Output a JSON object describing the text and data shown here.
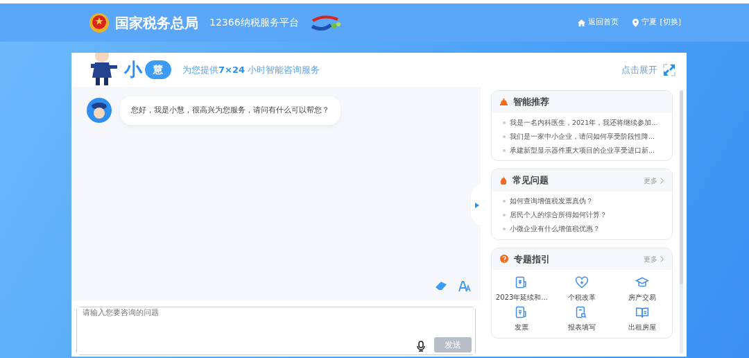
{
  "header": {
    "brand": "国家税务总局",
    "platform": "12366纳税服务平台",
    "nav": [
      {
        "kind": "home",
        "label": "返回首页"
      },
      {
        "kind": "location",
        "label": "宁夏"
      },
      {
        "kind": "switch",
        "label": "[切换]"
      }
    ]
  },
  "assistant": {
    "logo_a": "小",
    "logo_b": "慧",
    "tagline": "为您提供**7×24** 小时智能咨询服务",
    "expand": "点击展开"
  },
  "messages": [
    {
      "text": "您好，我是小慧，很高兴为您服务，请问有什么可以帮您？"
    }
  ],
  "input": {
    "placeholder": "请输入您要咨询的问题",
    "send": "发送",
    "send_disabled": true
  },
  "panels": [
    {
      "title": "智能推荐",
      "items": [
        "我是一名内科医生，2021年，我还将继续参加...",
        "我们是一家中小企业，请问如何享受阶段性降...",
        "承建新型显示器件重大项目的企业享受进口新..."
      ]
    },
    {
      "title": "常见问题",
      "more": "更多",
      "items": [
        "如何查询增值税发票真伪？",
        "居民个人的综合所得如何计算？",
        "小微企业有什么增值税优惠？"
      ]
    },
    {
      "title": "专题指引",
      "more": "更多",
      "topics": [
        {
          "label": "2023年延续和..."
        },
        {
          "label": "个税改革"
        },
        {
          "label": "房产交易"
        },
        {
          "label": "发票"
        },
        {
          "label": "报表填写"
        },
        {
          "label": "出租房屋"
        }
      ]
    }
  ]
}
